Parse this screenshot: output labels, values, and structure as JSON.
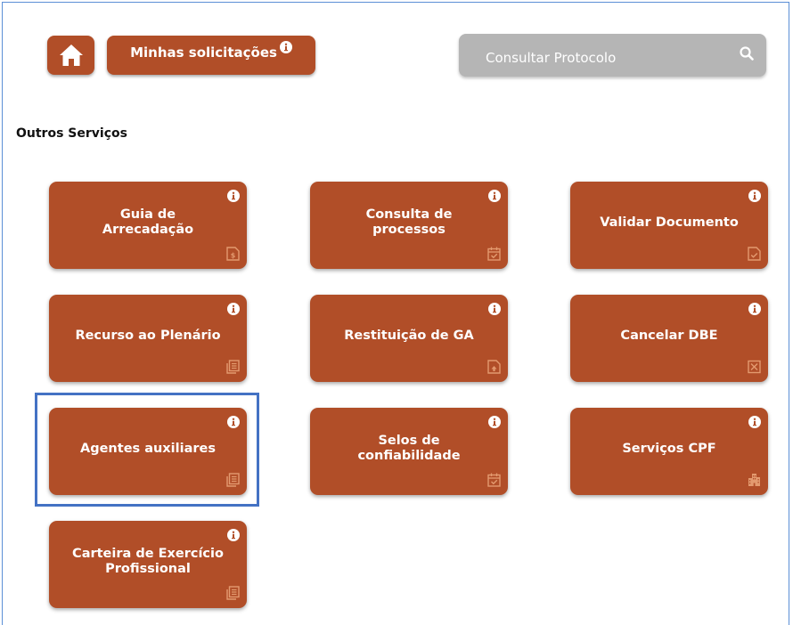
{
  "header": {
    "home_icon": "home-icon",
    "my_requests_label": "Minhas solicitações",
    "search_placeholder": "Consultar Protocolo",
    "search_icon": "search-icon"
  },
  "section": {
    "title": "Outros Serviços"
  },
  "cards": [
    {
      "label": "Guia de\nArrecadação",
      "icon": "invoice-document-icon"
    },
    {
      "label": "Consulta de\nprocessos",
      "icon": "calendar-check-icon"
    },
    {
      "label": "Validar Documento",
      "icon": "document-check-icon"
    },
    {
      "label": "Recurso ao Plenário",
      "icon": "documents-stack-icon"
    },
    {
      "label": "Restituição de GA",
      "icon": "document-upload-icon"
    },
    {
      "label": "Cancelar DBE",
      "icon": "close-box-icon"
    },
    {
      "label": "Agentes auxiliares",
      "icon": "documents-stack-icon"
    },
    {
      "label": "Selos de\nconfiabilidade",
      "icon": "calendar-check-icon"
    },
    {
      "label": "Serviços CPF",
      "icon": "building-icon"
    },
    {
      "label": "Carteira de Exercício\nProfissional",
      "icon": "documents-stack-icon"
    }
  ],
  "colors": {
    "accent": "#b14e28",
    "search_bg": "#b5b5b5",
    "highlight": "#4472c4",
    "frame": "#5b8fd6"
  }
}
